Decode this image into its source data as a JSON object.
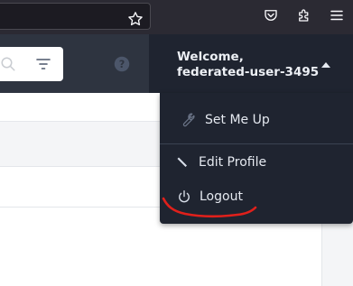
{
  "header": {
    "welcome_line1": "Welcome,",
    "welcome_line2": "federated-user-3495"
  },
  "user_menu": {
    "items": [
      {
        "label": "Set Me Up",
        "icon": "wrench-icon"
      },
      {
        "label": "Edit Profile",
        "icon": "pencil-icon"
      },
      {
        "label": "Logout",
        "icon": "power-icon"
      }
    ]
  },
  "colors": {
    "browser_bar": "#2b2a33",
    "app_header": "#2e3440",
    "dropdown_bg": "#1f2430",
    "annotation": "#e0201b"
  }
}
